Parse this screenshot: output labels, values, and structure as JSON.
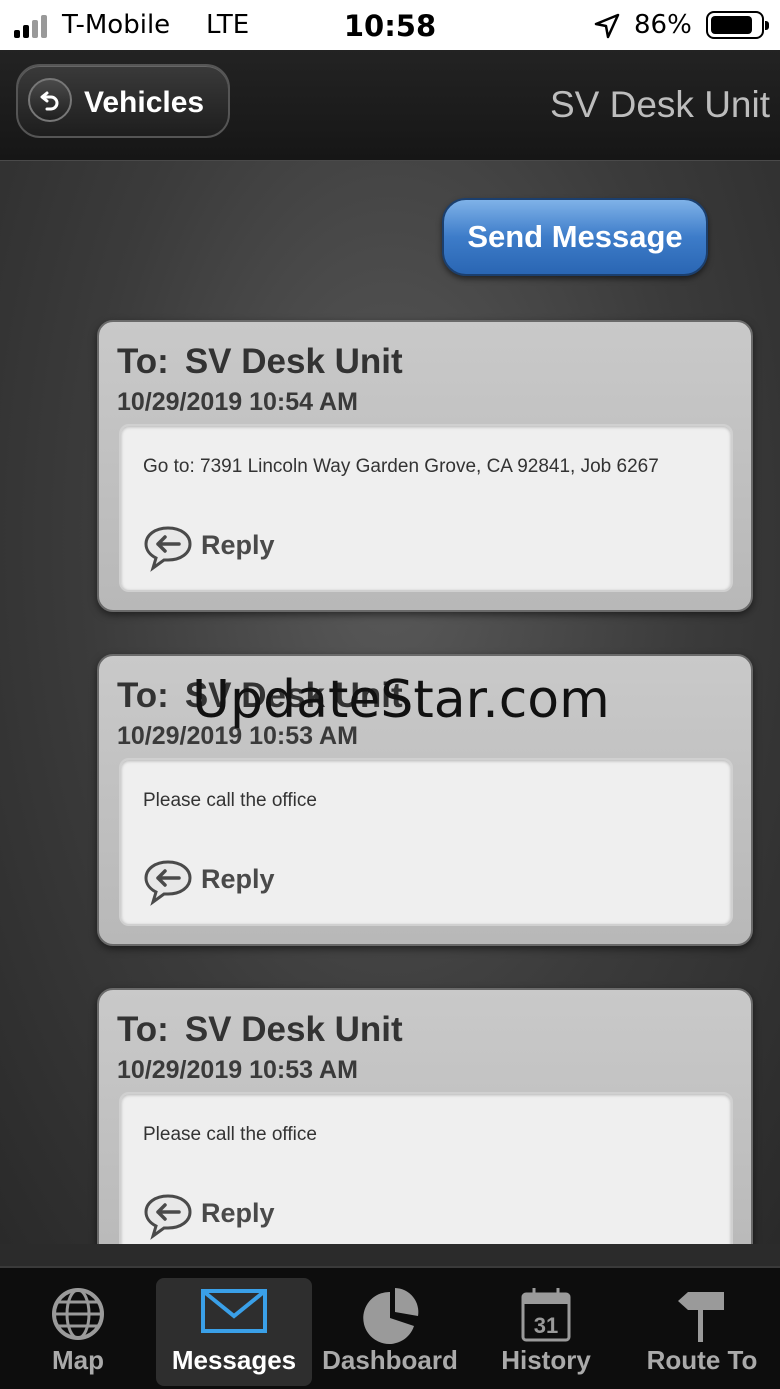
{
  "status_bar": {
    "carrier": "T-Mobile",
    "network": "LTE",
    "time": "10:58",
    "battery_percent": "86%",
    "battery_level": 0.86
  },
  "header": {
    "back_label": "Vehicles",
    "title": "SV Desk Unit"
  },
  "actions": {
    "send_message_label": "Send Message"
  },
  "messages": [
    {
      "to_label": "To:",
      "recipient": "SV Desk Unit",
      "timestamp": "10/29/2019 10:54 AM",
      "body": "Go to: 7391 Lincoln Way Garden Grove, CA 92841, Job 6267",
      "reply_label": "Reply"
    },
    {
      "to_label": "To:",
      "recipient": "SV Desk Unit",
      "timestamp": "10/29/2019 10:53 AM",
      "body": "Please call the office",
      "reply_label": "Reply"
    },
    {
      "to_label": "To:",
      "recipient": "SV Desk Unit",
      "timestamp": "10/29/2019 10:53 AM",
      "body": "Please call the office",
      "reply_label": "Reply"
    }
  ],
  "watermark": "UpdateStar.com",
  "tabs": [
    {
      "label": "Map",
      "icon": "globe-icon",
      "active": false
    },
    {
      "label": "Messages",
      "icon": "envelope-icon",
      "active": true
    },
    {
      "label": "Dashboard",
      "icon": "pie-chart-icon",
      "active": false
    },
    {
      "label": "History",
      "icon": "calendar-icon",
      "calendar_day": "31",
      "active": false
    },
    {
      "label": "Route To",
      "icon": "signpost-icon",
      "active": false
    }
  ],
  "colors": {
    "accent_button": "#3d7cc9",
    "active_tab_icon": "#3aa0e8"
  }
}
